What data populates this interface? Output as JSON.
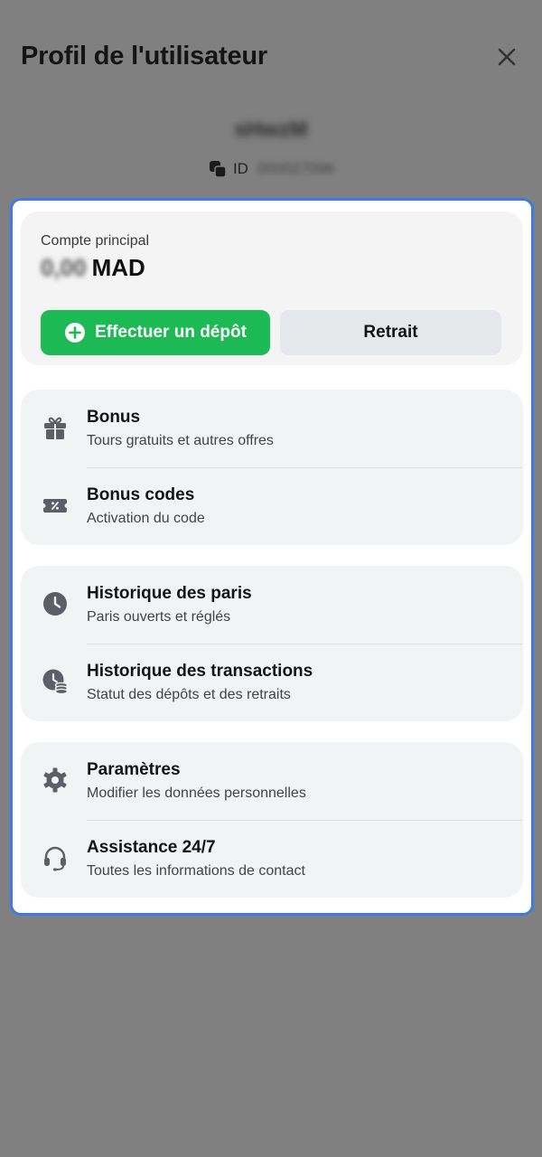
{
  "header": {
    "title": "Profil de l'utilisateur",
    "close_icon": "close-icon"
  },
  "user": {
    "name": "sHwzM",
    "id_label": "ID",
    "id_value": "000027096"
  },
  "balance": {
    "label": "Compte principal",
    "amount": "0,00",
    "currency": "MAD",
    "deposit_label": "Effectuer un dépôt",
    "withdraw_label": "Retrait"
  },
  "menu": [
    {
      "items": [
        {
          "title": "Bonus",
          "subtitle": "Tours gratuits et autres offres",
          "icon": "gift-icon"
        },
        {
          "title": "Bonus codes",
          "subtitle": "Activation du code",
          "icon": "coupon-icon"
        }
      ]
    },
    {
      "items": [
        {
          "title": "Historique des paris",
          "subtitle": "Paris ouverts et réglés",
          "icon": "clock-icon"
        },
        {
          "title": "Historique des transactions",
          "subtitle": "Statut des dépôts et des retraits",
          "icon": "clock-coins-icon"
        }
      ]
    },
    {
      "items": [
        {
          "title": "Paramètres",
          "subtitle": "Modifier les données personnelles",
          "icon": "gear-icon"
        },
        {
          "title": "Assistance 24/7",
          "subtitle": "Toutes les informations de contact",
          "icon": "headset-icon"
        }
      ]
    }
  ],
  "colors": {
    "accent_green": "#1db954",
    "highlight_border": "#3d7be0",
    "overlay": "#808080",
    "icon_gray": "#5c5f66"
  }
}
